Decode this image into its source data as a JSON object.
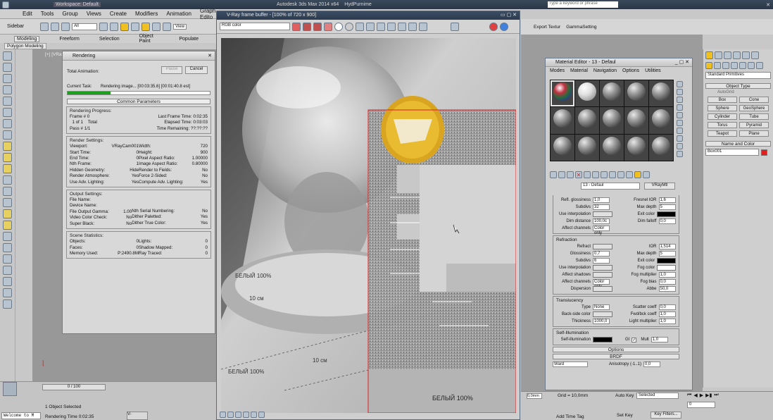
{
  "app": {
    "title": "Autodesk 3ds Max 2014 x64",
    "file": "HydPurnime",
    "workspace": "Workspace: Default",
    "search_placeholder": "Type a keyword or phrase"
  },
  "menu": [
    "Edit",
    "Tools",
    "Group",
    "Views",
    "Create",
    "Modifiers",
    "Animation",
    "Graph Edito"
  ],
  "toolbar": {
    "selection_label": "Sidebar",
    "filter": "All",
    "view": "View"
  },
  "ribbon": {
    "tabs": [
      "Modeling",
      "Freeform",
      "Selection",
      "Object Paint",
      "Populate"
    ],
    "sub": "Polygon Modeling"
  },
  "right_toolbar": [
    "Export Textur",
    "GammaSetting"
  ],
  "viewport_label": "[+] [VRayCam",
  "time": {
    "frame": "0 / 100"
  },
  "status": {
    "selected": "1 Object Selected",
    "render_time": "Rendering Time 0:02:35",
    "welcome": "Welcome to M"
  },
  "rendering": {
    "title": "Rendering",
    "total_animation": "Total Animation:",
    "pause": "Pause",
    "cancel": "Cancel",
    "current_task": "Current Task:",
    "task_value": "Rendering image... [00:03:35.6] [00:01:40.8 est]",
    "progress": 0.3,
    "common": "Common Parameters",
    "progress_group": "Rendering Progress:",
    "frame": "Frame #",
    "frame_val": "0",
    "of": "1 of",
    "of_val": "1",
    "total": "Total",
    "pass": "Pass #",
    "pass_val": "1/1",
    "last_frame": "Last Frame Time:",
    "last_frame_val": "0:02:35",
    "elapsed": "Elapsed Time:",
    "elapsed_val": "0:03:03",
    "remaining": "Time Remaining:",
    "remaining_val": "??:??:??",
    "settings_group": "Render Settings:",
    "settings_left": [
      [
        "Viewport:",
        "VRayCam001"
      ],
      [
        "Start Time:",
        "0"
      ],
      [
        "End Time:",
        "0"
      ],
      [
        "Nth Frame:",
        "1"
      ],
      [
        "Hidden Geometry:",
        "Hide"
      ],
      [
        "Render Atmosphere:",
        "Yes"
      ],
      [
        "Use Adv. Lighting:",
        "Yes"
      ]
    ],
    "settings_right": [
      [
        "Width:",
        "720"
      ],
      [
        "Height:",
        "900"
      ],
      [
        "Pixel Aspect Ratio:",
        "1.00000"
      ],
      [
        "Image Aspect Ratio:",
        "0.80000"
      ],
      [
        "Render to Fields:",
        "No"
      ],
      [
        "Force 2-Sided:",
        "No"
      ],
      [
        "Compute Adv. Lighting:",
        "Yes"
      ]
    ],
    "output_group": "Output Settings:",
    "output": [
      [
        "File Name:",
        ""
      ],
      [
        "Device Name:",
        ""
      ],
      [
        "File Output Gamma:",
        "1.00"
      ],
      [
        "Video Color Check:",
        "No"
      ],
      [
        "Super Black:",
        "No"
      ]
    ],
    "output_right": [
      [
        "Nth Serial Numbering:",
        "No"
      ],
      [
        "Dither Paletted:",
        "Yes"
      ],
      [
        "Dither True Color:",
        "Yes"
      ]
    ],
    "scene_group": "Scene Statistics:",
    "scene_left": [
      [
        "Objects:",
        "0"
      ],
      [
        "Faces:",
        "0"
      ],
      [
        "Memory Used:",
        "P:2490.8M"
      ]
    ],
    "scene_right": [
      [
        "Lights:",
        "0"
      ],
      [
        "Shadow Mapped:",
        "0"
      ],
      [
        "Ray Traced:",
        "0"
      ]
    ]
  },
  "vfb": {
    "title": "V-Ray frame buffer - [100% of 720 x 900]",
    "channel": "RGB color"
  },
  "scene_text": [
    "БЕЛЫЙ 100%",
    "10 см",
    "БЕЛЫЙ 100%",
    "10 см",
    "БЕЛЫЙ 100%"
  ],
  "med": {
    "title": "Material Editor - 13 - Defaul",
    "menu": [
      "Modes",
      "Material",
      "Navigation",
      "Options",
      "Utilities"
    ],
    "mat_name": "13 - Defaul",
    "mat_type": "VRayMtl",
    "refl": [
      [
        "Refl. glossiness",
        "1,0"
      ],
      [
        "Subdivs",
        "32"
      ],
      [
        "Use interpolation",
        ""
      ],
      [
        "Dim distance",
        "100,0c"
      ],
      [
        "Affect channels",
        "Color only"
      ]
    ],
    "refl_right": [
      [
        "Fresnel IOR",
        "1,6"
      ],
      [
        "Max depth",
        "5"
      ],
      [
        "Exit color",
        ""
      ],
      [
        "Dim falloff",
        "0,0"
      ]
    ],
    "refraction_title": "Refraction",
    "refr": [
      [
        "Refract",
        ""
      ],
      [
        "Glossiness",
        "0,7"
      ],
      [
        "Subdivs",
        "6"
      ],
      [
        "Use interpolation",
        ""
      ],
      [
        "Affect shadows",
        ""
      ],
      [
        "Affect channels",
        "Color only"
      ],
      [
        "Dispersion",
        ""
      ]
    ],
    "refr_right": [
      [
        "IOR",
        "1,514"
      ],
      [
        "Max depth",
        "5"
      ],
      [
        "Exit color",
        ""
      ],
      [
        "Fog color",
        ""
      ],
      [
        "Fog multiplier",
        "1,0"
      ],
      [
        "Fog bias",
        "0,0"
      ],
      [
        "Abbe",
        "50,0"
      ]
    ],
    "trans_title": "Translucency",
    "trans": [
      [
        "Type",
        "None"
      ],
      [
        "Back-side color",
        ""
      ],
      [
        "Thickness",
        "1000,0"
      ]
    ],
    "trans_right": [
      [
        "Scatter coeff",
        "0,0"
      ],
      [
        "Fwd/bck coeff",
        "1,0"
      ],
      [
        "Light multiplier",
        "1,0"
      ]
    ],
    "self_title": "Self-Illumination",
    "self": "Self-illumination",
    "gi": "GI",
    "mult": "Mult",
    "mult_val": "1,0",
    "options": "Options",
    "brdf": "BRDF",
    "brdf_type": "Ward",
    "aniso": "Anisotropy (-1..1)",
    "aniso_val": "0,0"
  },
  "cmd": {
    "category": "Standard Primitives",
    "obj_type": "Object Type",
    "autogrid": "AutoGrid",
    "buttons": [
      "Box",
      "Cone",
      "Sphere",
      "GeoSphere",
      "Cylinder",
      "Tube",
      "Torus",
      "Pyramid",
      "Teapot",
      "Plane"
    ],
    "name_color": "Name and Color",
    "name": "Box001"
  },
  "bottom_right": {
    "grid": "Grid = 10,0mm",
    "autokey": "Auto Key",
    "selected": "Selected",
    "setkey": "Set Key",
    "keyfilters": "Key Filters...",
    "addtime": "Add Time Tag",
    "x": "0,0mm",
    "frame": "0"
  },
  "colors": {
    "accent_red": "#e02020",
    "progress_green": "#1aa01a",
    "title_blue": "#2c3a4e"
  }
}
